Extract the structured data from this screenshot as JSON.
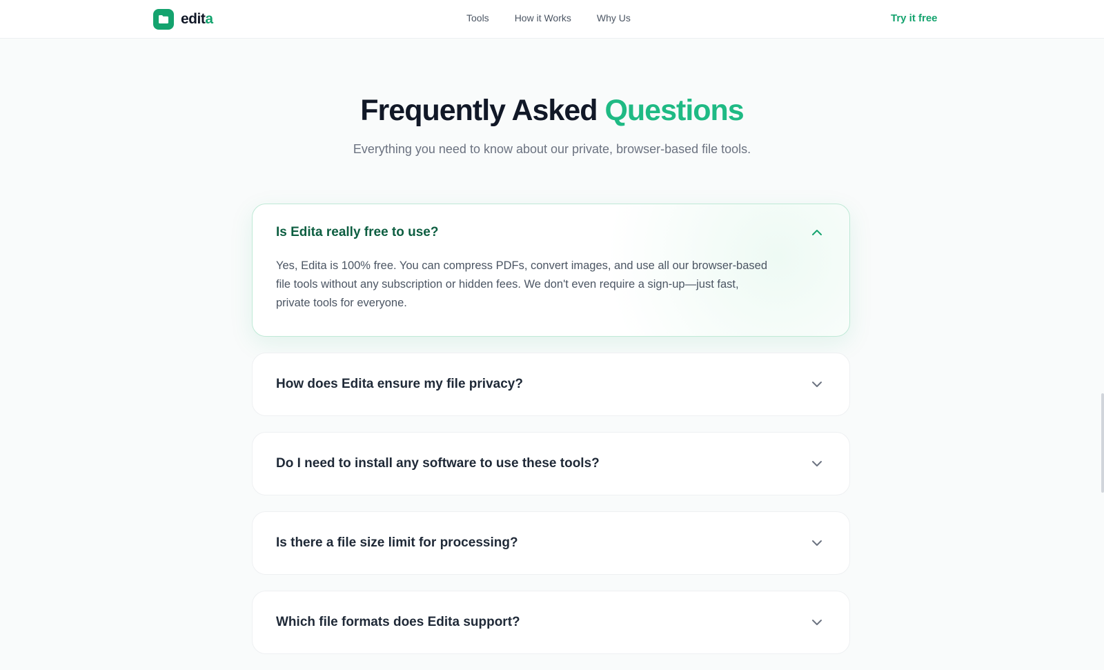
{
  "header": {
    "logo": {
      "text_main": "edit",
      "text_accent": "a",
      "icon": "folder-icon"
    },
    "nav": [
      "Tools",
      "How it Works",
      "Why Us"
    ],
    "cta_label": "Try it free"
  },
  "hero": {
    "title_main": "Frequently Asked ",
    "title_highlight": "Questions",
    "subtitle": "Everything you need to know about our private, browser-based file tools."
  },
  "faq": {
    "items": [
      {
        "question": "Is Edita really free to use?",
        "answer": "Yes, Edita is 100% free. You can compress PDFs, convert images, and use all our browser-based file tools without any subscription or hidden fees. We don't even require a sign-up—just fast, private tools for everyone.",
        "expanded": true
      },
      {
        "question": "How does Edita ensure my file privacy?",
        "expanded": false
      },
      {
        "question": "Do I need to install any software to use these tools?",
        "expanded": false
      },
      {
        "question": "Is there a file size limit for processing?",
        "expanded": false
      },
      {
        "question": "Which file formats does Edita support?",
        "expanded": false
      }
    ]
  },
  "colors": {
    "brand": "#14a36e",
    "highlight": "#1fba84",
    "text_dark": "#111827",
    "text_muted": "#6b7280"
  }
}
